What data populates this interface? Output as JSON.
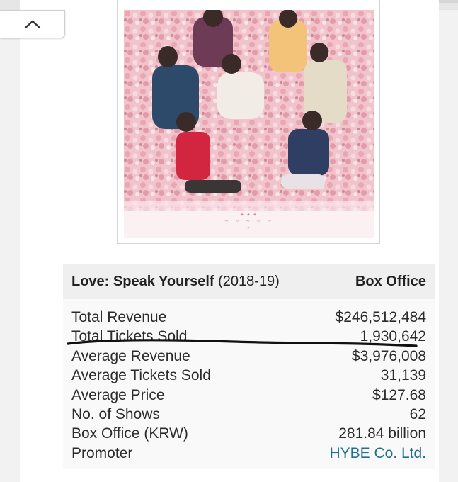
{
  "colors": {
    "link": "#1f6f93",
    "header_bg": "#efefef",
    "annotation_stroke": "#111111"
  },
  "toolbar": {
    "collapse_icon": "chevron-up-icon"
  },
  "table": {
    "tour_name": "Love: Speak Yourself",
    "tour_years": "(2018-19)",
    "column_header": "Box Office",
    "rows": [
      {
        "label": "Total Revenue",
        "value": "$246,512,484"
      },
      {
        "label": "Total Tickets Sold",
        "value": "1,930,642"
      },
      {
        "label": "Average Revenue",
        "value": "$3,976,008"
      },
      {
        "label": "Average Tickets Sold",
        "value": "31,139"
      },
      {
        "label": "Average Price",
        "value": "$127.68"
      },
      {
        "label": "No. of Shows",
        "value": "62"
      },
      {
        "label": "Box Office (KRW)",
        "value": "281.84 billion"
      },
      {
        "label": "Promoter",
        "value": "HYBE Co. Ltd."
      }
    ]
  }
}
